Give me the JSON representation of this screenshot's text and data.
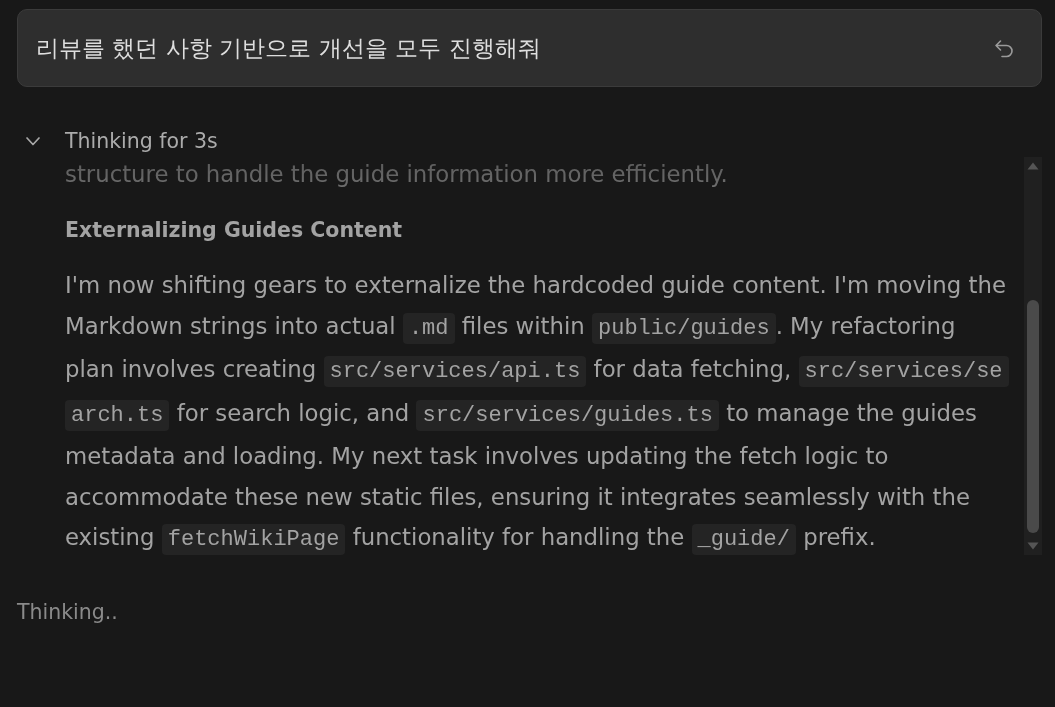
{
  "prompt": {
    "text": "리뷰를 했던 사항 기반으로 개선을 모두 진행해줘"
  },
  "thinking": {
    "label": "Thinking for 3s",
    "expanded": true,
    "blocks": [
      {
        "kind": "paragraph",
        "segments": [
          {
            "kind": "text",
            "text": "structure to handle the guide information more efficiently."
          }
        ]
      },
      {
        "kind": "heading",
        "text": "Externalizing Guides Content"
      },
      {
        "kind": "paragraph",
        "segments": [
          {
            "kind": "text",
            "text": "I'm now shifting gears to externalize the hardcoded guide content. I'm moving the Markdown strings into actual "
          },
          {
            "kind": "code",
            "text": ".md"
          },
          {
            "kind": "text",
            "text": " files within "
          },
          {
            "kind": "code",
            "text": "public/guides"
          },
          {
            "kind": "text",
            "text": ". My refactoring plan involves creating "
          },
          {
            "kind": "code",
            "text": "src/services/api.ts"
          },
          {
            "kind": "text",
            "text": " for data fetching, "
          },
          {
            "kind": "code",
            "text": "src/services/search.ts"
          },
          {
            "kind": "text",
            "text": " for search logic, and "
          },
          {
            "kind": "code",
            "text": "src/services/guides.ts"
          },
          {
            "kind": "text",
            "text": " to manage the guides metadata and loading. My next task involves updating the fetch logic to accommodate these new static files, ensuring it integrates seamlessly with the existing "
          },
          {
            "kind": "code",
            "text": "fetchWikiPage"
          },
          {
            "kind": "text",
            "text": " functionality for handling the "
          },
          {
            "kind": "code",
            "text": "_guide/"
          },
          {
            "kind": "text",
            "text": " prefix."
          }
        ]
      }
    ]
  },
  "status": {
    "text": "Thinking.."
  }
}
